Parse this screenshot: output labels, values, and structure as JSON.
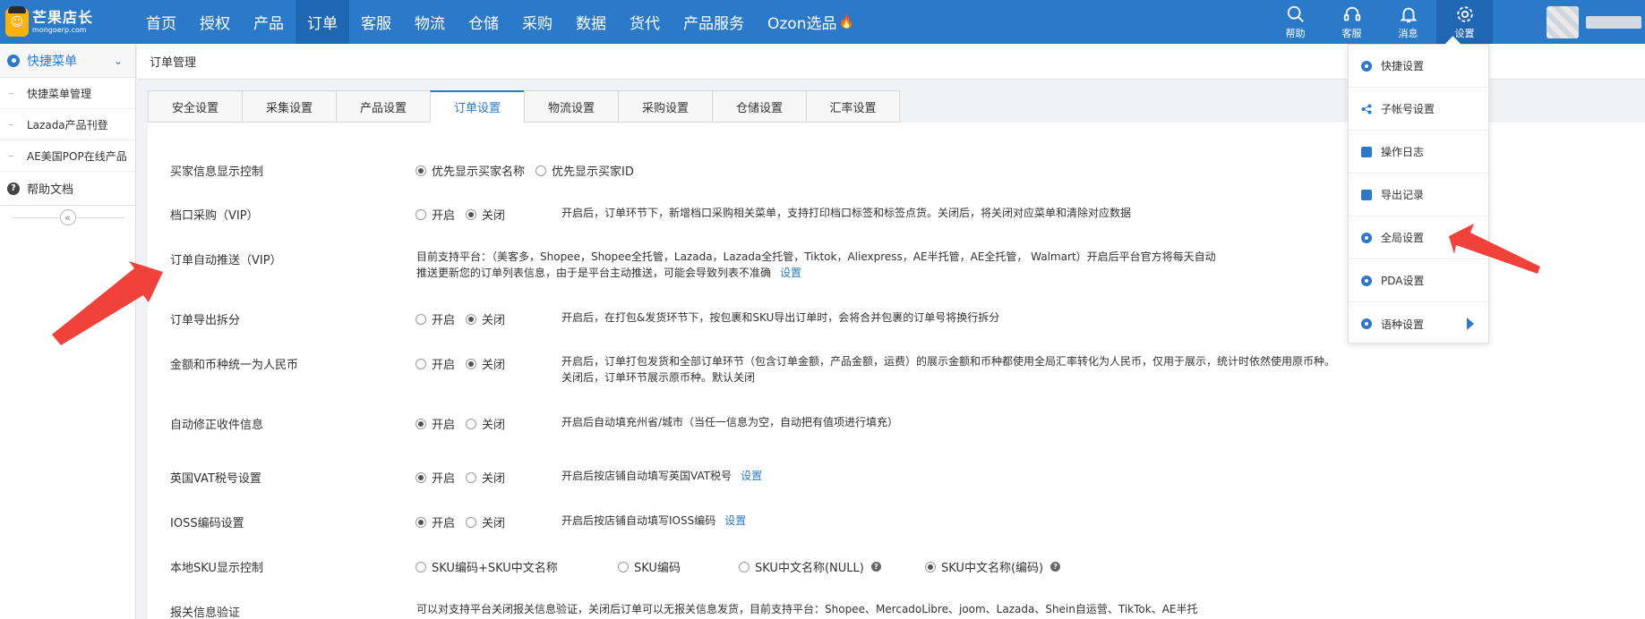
{
  "brand": {
    "name": "芒果店长",
    "domain": "mongoerp.com"
  },
  "nav": {
    "items": [
      {
        "label": "首页",
        "active": false
      },
      {
        "label": "授权",
        "active": false
      },
      {
        "label": "产品",
        "active": false
      },
      {
        "label": "订单",
        "active": true
      },
      {
        "label": "客服",
        "active": false
      },
      {
        "label": "物流",
        "active": false
      },
      {
        "label": "仓储",
        "active": false
      },
      {
        "label": "采购",
        "active": false
      },
      {
        "label": "数据",
        "active": false
      },
      {
        "label": "货代",
        "active": false
      },
      {
        "label": "产品服务",
        "active": false
      },
      {
        "label": "Ozon选品",
        "active": false,
        "icon": "fire-icon"
      }
    ]
  },
  "tools": {
    "help": "帮助",
    "service": "客服",
    "message": "消息",
    "settings": "设置"
  },
  "sidebar": {
    "title": "快捷菜单",
    "items": [
      {
        "label": "快捷菜单管理"
      },
      {
        "label": "Lazada产品刊登"
      },
      {
        "label": "AE美国POP在线产品"
      }
    ],
    "help": "帮助文档",
    "collapse": "«"
  },
  "breadcrumb": "订单管理",
  "tabs": [
    {
      "label": "安全设置",
      "active": false
    },
    {
      "label": "采集设置",
      "active": false
    },
    {
      "label": "产品设置",
      "active": false
    },
    {
      "label": "订单设置",
      "active": true
    },
    {
      "label": "物流设置",
      "active": false
    },
    {
      "label": "采购设置",
      "active": false
    },
    {
      "label": "仓储设置",
      "active": false
    },
    {
      "label": "汇率设置",
      "active": false
    }
  ],
  "settings": {
    "buyer_display": {
      "label": "买家信息显示控制",
      "opt1": "优先显示买家名称",
      "opt2": "优先显示买家ID",
      "selected": "opt1"
    },
    "stall_purchase": {
      "label": "档口采购（VIP）",
      "on": "开启",
      "off": "关闭",
      "selected": "off",
      "desc": "开启后，订单环节下，新增档口采购相关菜单，支持打印档口标签和标签点货。关闭后，将关闭对应菜单和清除对应数据"
    },
    "auto_push": {
      "label": "订单自动推送（VIP）",
      "desc1": "目前支持平台：（美客多，Shopee，Shopee全托管，Lazada，Lazada全托管，Tiktok，Aliexpress，AE半托管，AE全托管， Walmart）开启后平台官方将每天自动",
      "desc2": "推送更新您的订单列表信息，由于是平台主动推送，可能会导致列表不准确",
      "link": "设置"
    },
    "export_split": {
      "label": "订单导出拆分",
      "on": "开启",
      "off": "关闭",
      "selected": "off",
      "desc": "开启后，在打包&发货环节下，按包裹和SKU导出订单时，会将合并包裹的订单号将换行拆分"
    },
    "currency_rmb": {
      "label": "金额和币种统一为人民币",
      "on": "开启",
      "off": "关闭",
      "selected": "off",
      "desc1": "开启后，订单打包发货和全部订单环节（包含订单金额，产品金额，运费）的展示金额和币种都使用全局汇率转化为人民币，仅用于展示，统计时依然使用原币种。",
      "desc2": "关闭后，订单环节展示原币种。默认关闭"
    },
    "auto_fix_address": {
      "label": "自动修正收件信息",
      "on": "开启",
      "off": "关闭",
      "selected": "on",
      "desc": "开启后自动填充州省/城市（当任一信息为空，自动把有值项进行填充）"
    },
    "uk_vat": {
      "label": "英国VAT税号设置",
      "on": "开启",
      "off": "关闭",
      "selected": "on",
      "desc": "开启后按店铺自动填写英国VAT税号",
      "link": "设置"
    },
    "ioss": {
      "label": "IOSS编码设置",
      "on": "开启",
      "off": "关闭",
      "selected": "on",
      "desc": "开启后按店铺自动填写IOSS编码",
      "link": "设置"
    },
    "local_sku": {
      "label": "本地SKU显示控制",
      "opt1": "SKU编码+SKU中文名称",
      "opt2": "SKU编码",
      "opt3": "SKU中文名称(NULL)",
      "opt4": "SKU中文名称(编码)",
      "selected": "opt4"
    },
    "customs": {
      "label": "报关信息验证",
      "desc": "可以对支持平台关闭报关信息验证，关闭后订单可以无报关信息发货，目前支持平台：Shopee、MercadoLibre、joom、Lazada、Shein自运营、TikTok、AE半托"
    }
  },
  "dropdown": {
    "items": [
      {
        "label": "快捷设置",
        "icon": "gear-icon"
      },
      {
        "label": "子帐号设置",
        "icon": "share-icon"
      },
      {
        "label": "操作日志",
        "icon": "doc-icon"
      },
      {
        "label": "导出记录",
        "icon": "doc-icon"
      },
      {
        "label": "全局设置",
        "icon": "gear-icon"
      },
      {
        "label": "PDA设置",
        "icon": "gear-icon"
      },
      {
        "label": "语种设置",
        "icon": "gear-icon",
        "has_submenu": true
      }
    ]
  },
  "colors": {
    "primary": "#2b7ac9",
    "nav_active": "#1f67b3",
    "annotation_arrow": "#f0413a"
  }
}
